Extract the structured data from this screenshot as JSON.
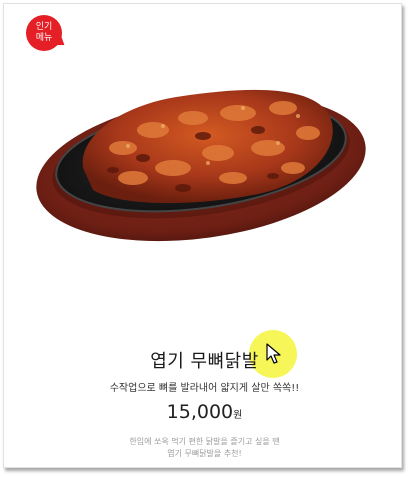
{
  "badge": {
    "line1": "인기",
    "line2": "메뉴"
  },
  "product": {
    "name": "엽기 무뼈닭발",
    "subtitle": "수작업으로 뼈를 발라내어 얇지게 살만 쏙쏙!!",
    "price": "15,000",
    "currency": "원",
    "description_line1": "한입에 쏘옥 먹기 편한 닭발을 즐기고 싶을 땐",
    "description_line2": "엽기 무뼈닭발을 추천!"
  },
  "colors": {
    "badge": "#e41f25",
    "cursor_highlight": "#f5f53c"
  },
  "icons": {
    "cursor": "mouse-pointer-icon"
  }
}
